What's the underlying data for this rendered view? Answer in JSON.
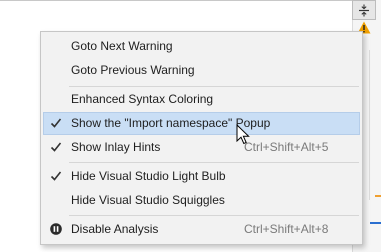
{
  "menu": {
    "items": [
      {
        "label": "Goto Next Warning",
        "checked": false
      },
      {
        "label": "Goto Previous Warning",
        "checked": false
      },
      {
        "label": "Enhanced Syntax Coloring",
        "checked": false
      },
      {
        "label": "Show the \"Import namespace\" Popup",
        "checked": true,
        "highlighted": true
      },
      {
        "label": "Show Inlay Hints",
        "checked": true,
        "shortcut": "Ctrl+Shift+Alt+5"
      },
      {
        "label": "Hide Visual Studio Light Bulb",
        "checked": true
      },
      {
        "label": "Hide Visual Studio Squiggles",
        "checked": false
      },
      {
        "label": "Disable Analysis",
        "icon": "pause-icon",
        "shortcut": "Ctrl+Shift+Alt+8"
      }
    ]
  },
  "toolbar": {
    "split_icon": "split-view-icon",
    "warning_icon": "warning-icon"
  },
  "colors": {
    "highlight": "#c9def5",
    "menu_background": "#f2f2f2",
    "shortcut_text": "#7a7a7a",
    "warning": "#f0a000"
  }
}
